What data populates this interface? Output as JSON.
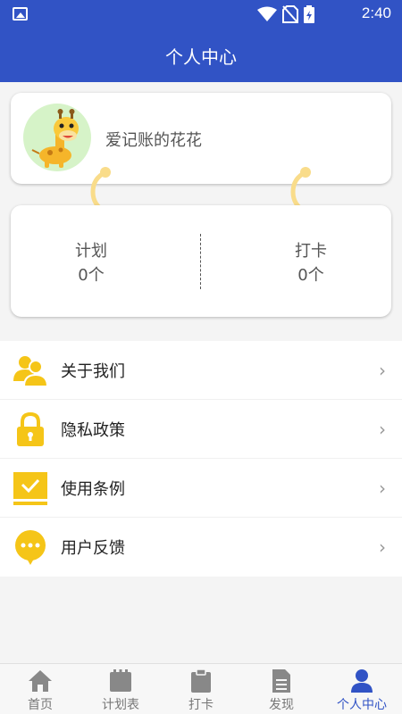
{
  "status_bar": {
    "time": "2:40"
  },
  "header": {
    "title": "个人中心"
  },
  "profile": {
    "name": "爱记账的花花"
  },
  "stats": [
    {
      "label": "计划",
      "value": "0个"
    },
    {
      "label": "打卡",
      "value": "0个"
    }
  ],
  "menu": [
    {
      "label": "关于我们",
      "icon": "users-icon"
    },
    {
      "label": "隐私政策",
      "icon": "lock-icon"
    },
    {
      "label": "使用条例",
      "icon": "checkbox-icon"
    },
    {
      "label": "用户反馈",
      "icon": "chat-icon"
    }
  ],
  "tabs": [
    {
      "label": "首页",
      "icon": "home-icon",
      "active": false
    },
    {
      "label": "计划表",
      "icon": "calendar-icon",
      "active": false
    },
    {
      "label": "打卡",
      "icon": "clipboard-icon",
      "active": false
    },
    {
      "label": "发现",
      "icon": "document-icon",
      "active": false
    },
    {
      "label": "个人中心",
      "icon": "person-icon",
      "active": true
    }
  ],
  "colors": {
    "primary": "#3153c5",
    "accent_yellow": "#f5c518",
    "chain_yellow": "#f9dc8a"
  }
}
